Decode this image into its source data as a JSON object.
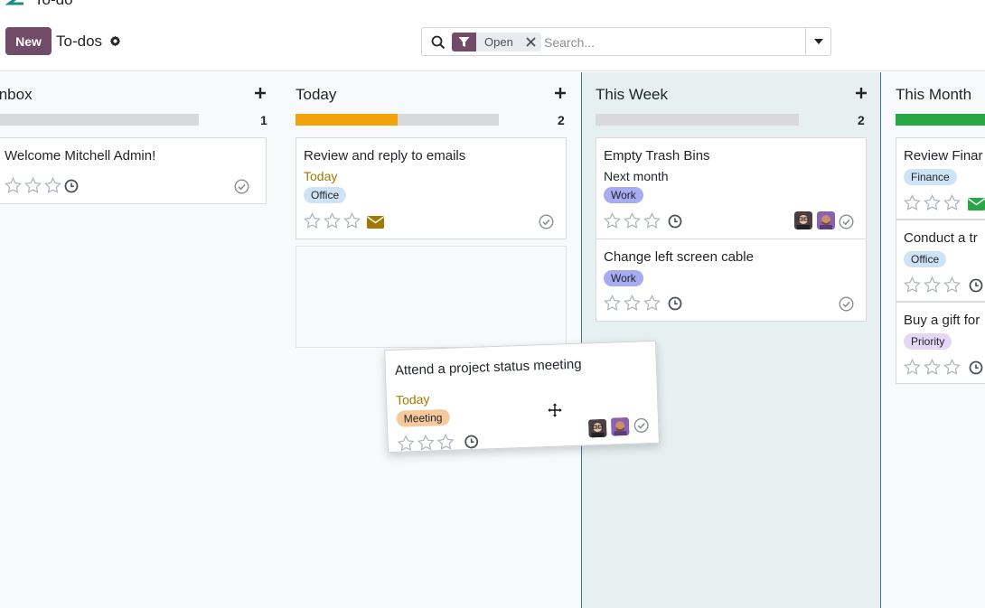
{
  "app": {
    "name": "To-do"
  },
  "toolbar": {
    "new_label": "New",
    "title": "To-dos"
  },
  "search": {
    "facet_label": "Open",
    "placeholder": "Search..."
  },
  "columns": [
    {
      "title": "Inbox",
      "count": "1",
      "progress": {
        "fill": 0,
        "color": "#d8d9dd"
      }
    },
    {
      "title": "Today",
      "count": "2",
      "progress": {
        "fill": 0.5,
        "color": "#f0a30a"
      }
    },
    {
      "title": "This Week",
      "count": "2",
      "progress": {
        "fill": 0,
        "color": "#d8d9dd"
      }
    },
    {
      "title": "This Month",
      "count": "",
      "progress": {
        "fill": 0.75,
        "color": "#28a745"
      }
    }
  ],
  "cards": {
    "inbox_welcome": {
      "title": "Welcome Mitchell Admin!"
    },
    "today_review": {
      "title": "Review and reply to emails",
      "date": "Today",
      "tag": "Office"
    },
    "week_trash": {
      "title": "Empty Trash Bins",
      "date": "Next month",
      "tag": "Work"
    },
    "week_cable": {
      "title": "Change left screen cable",
      "tag": "Work"
    },
    "month_finance": {
      "title": "Review Finar",
      "tag": "Finance"
    },
    "month_conduct": {
      "title": "Conduct a tr",
      "tag": "Office"
    },
    "month_gift": {
      "title": "Buy a gift for",
      "tag": "Priority"
    },
    "dragging": {
      "title": "Attend a project status meeting",
      "date": "Today",
      "tag": "Meeting"
    }
  },
  "colors": {
    "brand": "#714b67",
    "today_text": "#a07a00",
    "tag_office": "#cfe3f7",
    "tag_work": "#a6abf2",
    "tag_finance": "#cfe3f7",
    "tag_priority": "#e6d8f5",
    "tag_meeting": "#f7c99a",
    "mail_today": "#a07a00",
    "mail_month": "#28a745"
  }
}
